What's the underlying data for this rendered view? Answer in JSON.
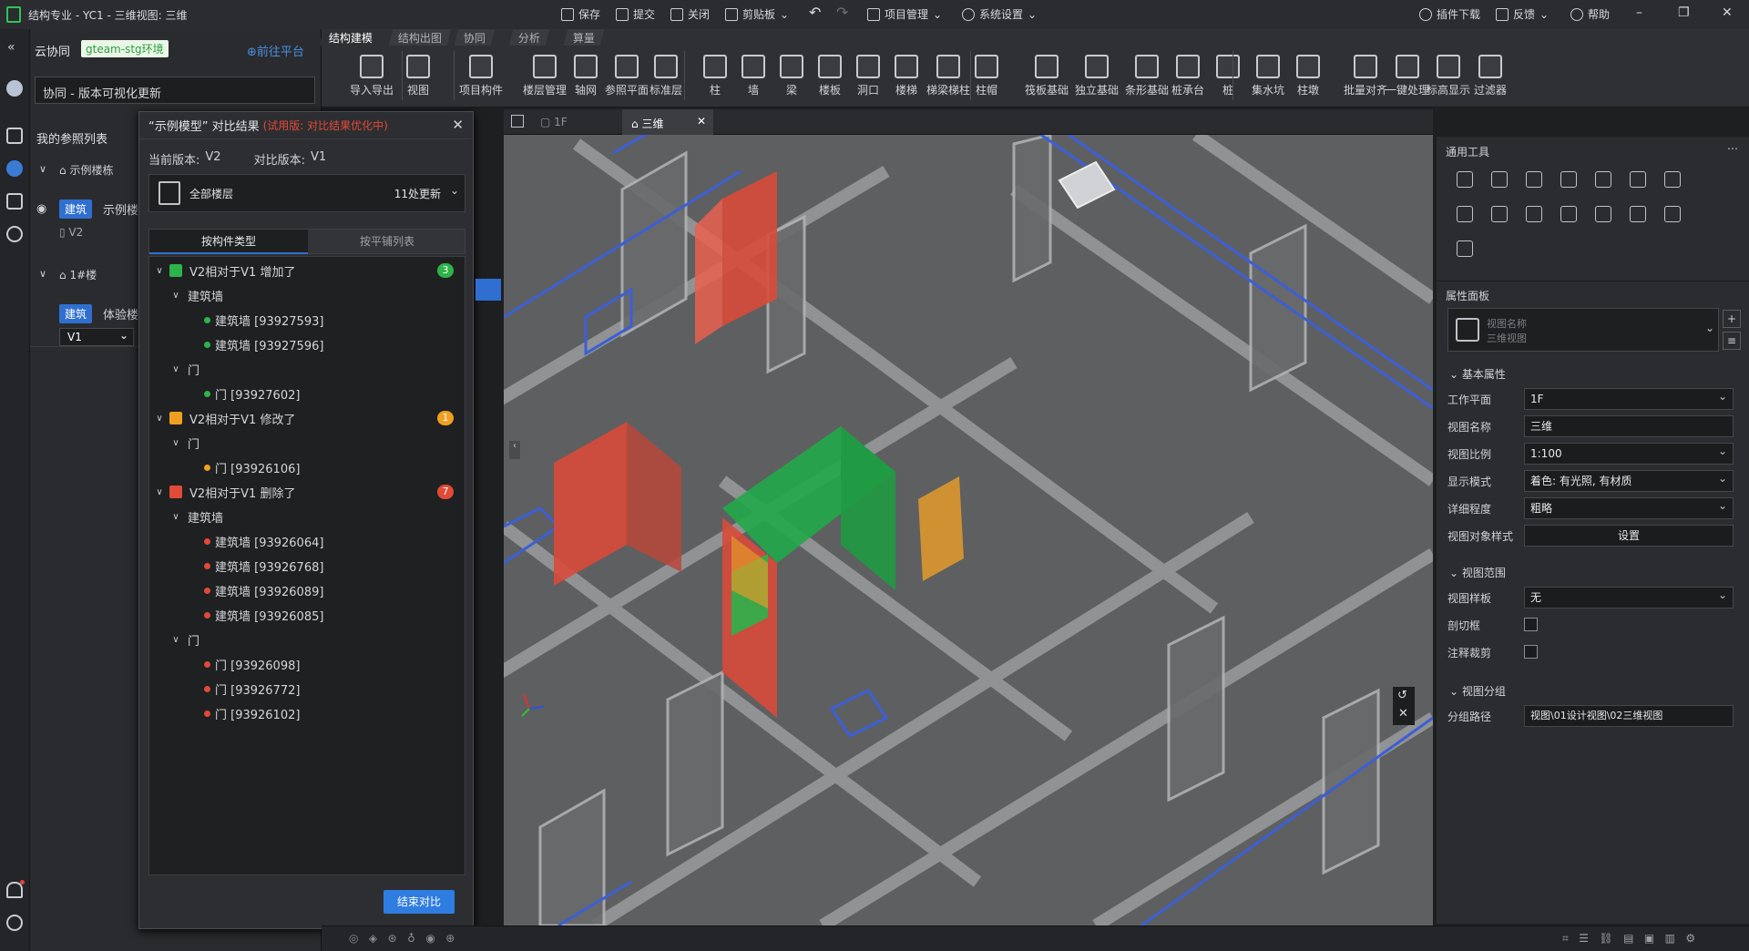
{
  "titlebar": {
    "title": "结构专业 - YC1 - 三维视图: 三维",
    "buttons": [
      "保存",
      "提交",
      "关闭",
      "剪贴板",
      "项目管理",
      "系统设置"
    ],
    "right": [
      "插件下载",
      "反馈",
      "帮助"
    ]
  },
  "collab": {
    "title": "云协同",
    "env_badge": "gteam-stg环境",
    "platform_link": "前往平台",
    "version_search": "协同 - 版本可视化更新",
    "my_refs": "我的参照列表",
    "tree": [
      {
        "label": "示例楼栋"
      },
      {
        "tag": "建筑",
        "label": "示例楼",
        "v": "V2"
      },
      {
        "label": "1#楼"
      },
      {
        "tag": "建筑",
        "label": "体验楼",
        "v": "V1"
      }
    ]
  },
  "compare": {
    "title": "“示例模型” 对比结果",
    "trial_note": "(试用版: 对比结果优化中)",
    "current_version_label": "当前版本:",
    "current_version": "V2",
    "compare_version_label": "对比版本:",
    "compare_version": "V1",
    "floor": "全部楼层",
    "update_count": "11处更新",
    "tabs": [
      "按构件类型",
      "按平铺列表"
    ],
    "groups": [
      {
        "label": "V2相对于V1 增加了",
        "color": "#2db34a",
        "count": "3",
        "sub": [
          {
            "label": "建筑墙",
            "items": [
              "建筑墙 [93927593]",
              "建筑墙 [93927596]"
            ]
          },
          {
            "label": "门",
            "items": [
              "门 [93927602]"
            ]
          }
        ]
      },
      {
        "label": "V2相对于V1 修改了",
        "color": "#f0a020",
        "count": "1",
        "sub": [
          {
            "label": "门",
            "items": [
              "门 [93926106]"
            ]
          }
        ]
      },
      {
        "label": "V2相对于V1 删除了",
        "color": "#e04a36",
        "count": "7",
        "sub": [
          {
            "label": "建筑墙",
            "items": [
              "建筑墙 [93926064]",
              "建筑墙 [93926768]",
              "建筑墙 [93926089]",
              "建筑墙 [93926085]"
            ]
          },
          {
            "label": "门",
            "items": [
              "门 [93926098]",
              "门 [93926772]",
              "门 [93926102]"
            ]
          }
        ]
      }
    ],
    "end_button": "结束对比"
  },
  "ribbon": {
    "tabs": [
      "结构建模",
      "结构出图",
      "协同",
      "分析",
      "算量"
    ],
    "tools": [
      "导入导出",
      "视图",
      "项目构件",
      "楼层管理",
      "轴网",
      "参照平面",
      "标准层",
      "柱",
      "墙",
      "梁",
      "楼板",
      "洞口",
      "楼梯",
      "梯梁梯柱",
      "柱帽",
      "筏板基础",
      "独立基础",
      "条形基础",
      "桩承台",
      "桩",
      "集水坑",
      "柱墩",
      "批量对齐",
      "一键处理",
      "标高显示",
      "过滤器"
    ]
  },
  "view_tabs": [
    {
      "label": "1F"
    },
    {
      "label": "三维"
    }
  ],
  "right_panel": {
    "tools_title": "通用工具",
    "props_title": "属性面板",
    "view_name_ph": "视图名称",
    "view_type": "三维视图",
    "basic_section": "基本属性",
    "rows": [
      {
        "label": "工作平面",
        "value": "1F",
        "select": true
      },
      {
        "label": "视图名称",
        "value": "三维",
        "select": false
      },
      {
        "label": "视图比例",
        "value": "1:100",
        "select": true
      },
      {
        "label": "显示模式",
        "value": "着色: 有光照, 有材质",
        "select": true
      },
      {
        "label": "详细程度",
        "value": "粗略",
        "select": true
      },
      {
        "label": "视图对象样式",
        "value": "设置",
        "select": false
      }
    ],
    "range_section": "视图范围",
    "template_label": "视图样板",
    "template_value": "无",
    "cut_label": "剖切框",
    "annot_label": "注释裁剪",
    "group_section": "视图分组",
    "path_label": "分组路径",
    "path_value": "视图\\01设计视图\\02三维视图"
  }
}
